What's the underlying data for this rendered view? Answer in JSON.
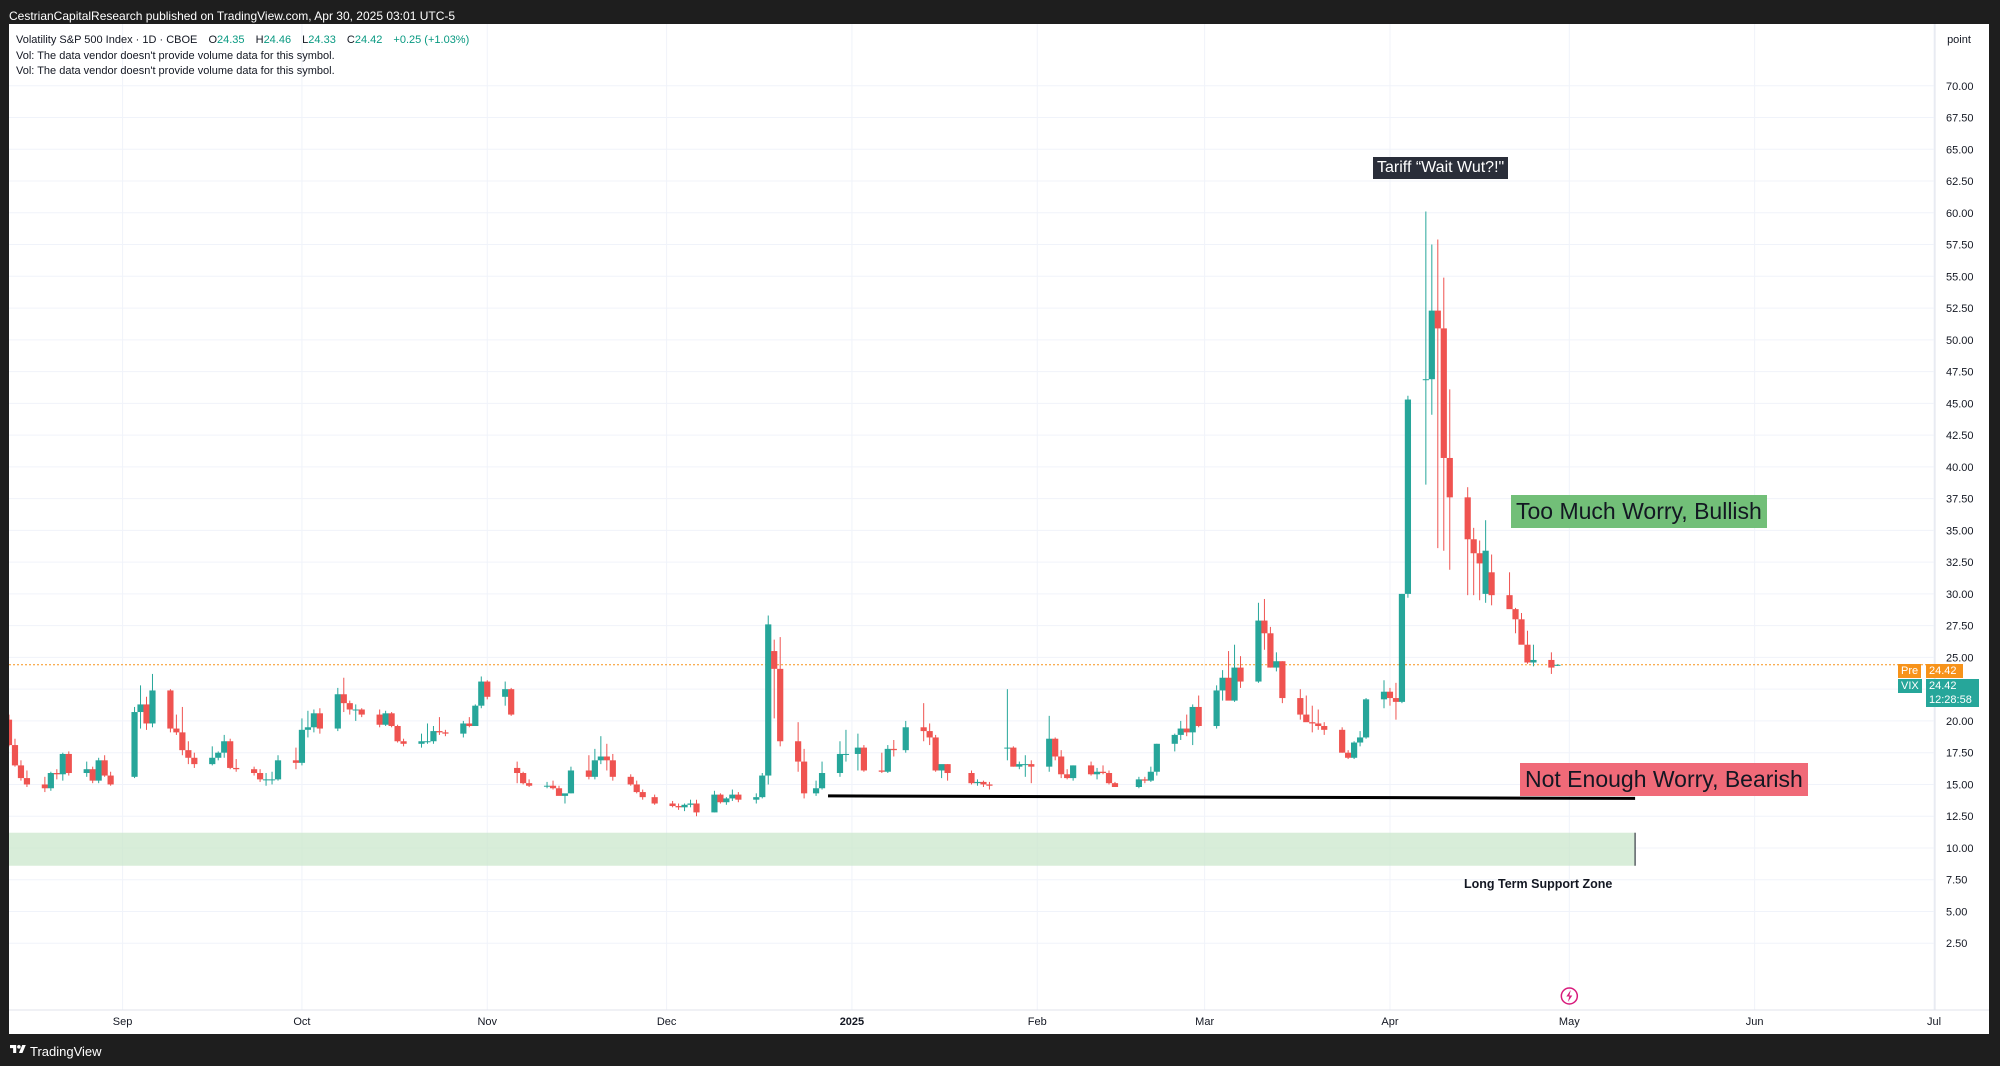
{
  "header": {
    "published": "CestrianCapitalResearch published on TradingView.com, Apr 30, 2025 03:01 UTC-5"
  },
  "footer": {
    "brand": "TradingView",
    "logo_icon": "tradingview-logo-icon"
  },
  "legend": {
    "symbol_line": "Volatility S&P 500 Index · 1D · CBOE",
    "open_label": "O",
    "open": "24.35",
    "high_label": "H",
    "high": "24.46",
    "low_label": "L",
    "low": "24.33",
    "close_label": "C",
    "close": "24.42",
    "change": "+0.25 (+1.03%)",
    "vol_note_1": "Vol: The data vendor doesn't provide volume data for this symbol.",
    "vol_note_2": "Vol: The data vendor doesn't provide volume data for this symbol."
  },
  "annotations": {
    "tariff": "Tariff “Wait Wut?!\"",
    "bullish": "Too Much Worry, Bullish",
    "bearish": "Not Enough Worry, Bearish",
    "support": "Long Term Support Zone"
  },
  "price_tags": {
    "pre_label": "Pre",
    "pre_value": "24.42",
    "vix_label": "VIX",
    "vix_value": "24.42",
    "countdown": "12:28:58"
  },
  "colors": {
    "up": "#26a69a",
    "down": "#ef5350",
    "grid": "#f0f3fa",
    "support_zone": "#c8e6c9",
    "bull_box": "#72bf78",
    "bear_box": "#f06a78",
    "pre_tag": "#f7931a",
    "last_price_line": "#f7931a"
  },
  "chart_data": {
    "type": "candlestick",
    "symbol": "VIX",
    "timeframe": "1D",
    "y_axis_unit": "point",
    "ylim": [
      0,
      72.5
    ],
    "y_ticks": [
      "2.50",
      "5.00",
      "7.50",
      "10.00",
      "12.50",
      "15.00",
      "17.50",
      "20.00",
      "22.50",
      "25.00",
      "27.50",
      "30.00",
      "32.50",
      "35.00",
      "37.50",
      "40.00",
      "42.50",
      "45.00",
      "47.50",
      "50.00",
      "52.50",
      "55.00",
      "57.50",
      "60.00",
      "62.50",
      "65.00",
      "67.50",
      "70.00"
    ],
    "x_ticks": [
      {
        "label": "Sep",
        "date": "2024-09-01"
      },
      {
        "label": "Oct",
        "date": "2024-10-01"
      },
      {
        "label": "Nov",
        "date": "2024-11-01"
      },
      {
        "label": "Dec",
        "date": "2024-12-01"
      },
      {
        "label": "2025",
        "date": "2025-01-01"
      },
      {
        "label": "Feb",
        "date": "2025-02-01"
      },
      {
        "label": "Mar",
        "date": "2025-03-01"
      },
      {
        "label": "Apr",
        "date": "2025-04-01"
      },
      {
        "label": "May",
        "date": "2025-05-01"
      },
      {
        "label": "Jun",
        "date": "2025-06-01"
      },
      {
        "label": "Jul",
        "date": "2025-07-01"
      }
    ],
    "x_range": [
      "2024-08-13",
      "2025-07-01"
    ],
    "last_price": 24.42,
    "support_line": {
      "from": "2024-12-28",
      "to": "2025-05-12",
      "y_start": 14.1,
      "y_end": 13.9
    },
    "support_zone": {
      "y_low": 8.6,
      "y_high": 11.2,
      "from": "2024-08-13",
      "to": "2025-05-12"
    },
    "candles": [
      [
        "2024-08-13",
        20.1,
        20.5,
        18.0,
        18.1
      ],
      [
        "2024-08-14",
        18.1,
        18.6,
        16.4,
        16.5
      ],
      [
        "2024-08-15",
        16.5,
        16.9,
        15.3,
        15.5
      ],
      [
        "2024-08-16",
        15.5,
        16.1,
        14.8,
        15.0
      ],
      [
        "2024-08-19",
        15.0,
        15.6,
        14.4,
        14.7
      ],
      [
        "2024-08-20",
        14.7,
        16.0,
        14.5,
        15.9
      ],
      [
        "2024-08-21",
        15.9,
        16.2,
        15.4,
        15.8
      ],
      [
        "2024-08-22",
        15.8,
        17.5,
        15.3,
        17.4
      ],
      [
        "2024-08-23",
        17.4,
        17.6,
        15.7,
        15.9
      ],
      [
        "2024-08-26",
        15.9,
        16.8,
        15.6,
        16.2
      ],
      [
        "2024-08-27",
        16.2,
        16.4,
        15.1,
        15.3
      ],
      [
        "2024-08-28",
        15.3,
        17.1,
        15.1,
        16.9
      ],
      [
        "2024-08-29",
        16.9,
        17.3,
        15.6,
        15.7
      ],
      [
        "2024-08-30",
        15.7,
        16.0,
        14.9,
        15.0
      ],
      [
        "2024-09-03",
        15.6,
        21.1,
        15.5,
        20.7
      ],
      [
        "2024-09-04",
        20.7,
        22.8,
        19.4,
        21.3
      ],
      [
        "2024-09-05",
        21.3,
        21.9,
        19.3,
        19.8
      ],
      [
        "2024-09-06",
        19.8,
        23.7,
        19.5,
        22.4
      ],
      [
        "2024-09-09",
        22.4,
        22.5,
        19.1,
        19.4
      ],
      [
        "2024-09-10",
        19.4,
        20.5,
        18.9,
        19.1
      ],
      [
        "2024-09-11",
        19.1,
        21.1,
        17.3,
        17.7
      ],
      [
        "2024-09-12",
        17.7,
        18.4,
        16.6,
        17.1
      ],
      [
        "2024-09-13",
        17.1,
        17.5,
        16.3,
        16.6
      ],
      [
        "2024-09-16",
        16.6,
        18.0,
        16.5,
        17.1
      ],
      [
        "2024-09-17",
        17.1,
        17.6,
        16.9,
        17.5
      ],
      [
        "2024-09-18",
        17.5,
        18.9,
        17.1,
        18.4
      ],
      [
        "2024-09-19",
        18.4,
        18.6,
        16.2,
        16.3
      ],
      [
        "2024-09-20",
        16.3,
        17.0,
        16.0,
        16.2
      ],
      [
        "2024-09-23",
        16.2,
        16.4,
        15.7,
        15.9
      ],
      [
        "2024-09-24",
        15.9,
        16.2,
        15.2,
        15.4
      ],
      [
        "2024-09-25",
        15.4,
        15.9,
        14.9,
        15.4
      ],
      [
        "2024-09-26",
        15.4,
        16.0,
        15.0,
        15.4
      ],
      [
        "2024-09-27",
        15.4,
        17.3,
        15.3,
        16.9
      ],
      [
        "2024-09-30",
        16.9,
        17.9,
        16.2,
        16.7
      ],
      [
        "2024-10-01",
        16.7,
        20.2,
        16.5,
        19.3
      ],
      [
        "2024-10-02",
        19.3,
        20.8,
        18.7,
        19.5
      ],
      [
        "2024-10-03",
        19.5,
        20.9,
        19.1,
        20.6
      ],
      [
        "2024-10-04",
        20.6,
        21.0,
        19.0,
        19.4
      ],
      [
        "2024-10-07",
        19.4,
        22.6,
        19.2,
        22.1
      ],
      [
        "2024-10-08",
        22.1,
        23.4,
        20.7,
        21.4
      ],
      [
        "2024-10-09",
        21.4,
        21.6,
        20.5,
        20.9
      ],
      [
        "2024-10-10",
        20.9,
        21.3,
        20.0,
        20.9
      ],
      [
        "2024-10-11",
        20.9,
        21.0,
        20.3,
        20.5
      ],
      [
        "2024-10-14",
        20.5,
        20.9,
        19.5,
        19.7
      ],
      [
        "2024-10-15",
        19.7,
        20.8,
        19.6,
        20.6
      ],
      [
        "2024-10-16",
        20.6,
        20.7,
        19.5,
        19.6
      ],
      [
        "2024-10-17",
        19.6,
        19.7,
        18.3,
        18.4
      ],
      [
        "2024-10-18",
        18.4,
        18.6,
        18.0,
        18.2
      ],
      [
        "2024-10-21",
        18.2,
        19.0,
        17.9,
        18.4
      ],
      [
        "2024-10-22",
        18.4,
        19.8,
        18.2,
        18.4
      ],
      [
        "2024-10-23",
        18.4,
        19.6,
        18.2,
        19.2
      ],
      [
        "2024-10-24",
        19.2,
        20.3,
        18.9,
        19.1
      ],
      [
        "2024-10-25",
        19.1,
        19.3,
        18.8,
        19.0
      ],
      [
        "2024-10-28",
        19.0,
        20.0,
        18.7,
        19.8
      ],
      [
        "2024-10-29",
        19.8,
        20.3,
        19.5,
        19.6
      ],
      [
        "2024-10-30",
        19.6,
        21.3,
        19.6,
        21.2
      ],
      [
        "2024-10-31",
        21.2,
        23.5,
        21.0,
        23.1
      ],
      [
        "2024-11-01",
        23.1,
        23.2,
        21.7,
        21.9
      ],
      [
        "2024-11-04",
        21.9,
        23.1,
        21.2,
        22.5
      ],
      [
        "2024-11-05",
        22.5,
        22.6,
        20.4,
        20.5
      ],
      [
        "2024-11-06",
        16.3,
        16.8,
        15.1,
        15.9
      ],
      [
        "2024-11-07",
        15.9,
        16.0,
        15.0,
        15.1
      ],
      [
        "2024-11-08",
        15.1,
        15.4,
        14.8,
        14.9
      ],
      [
        "2024-11-11",
        14.9,
        15.2,
        14.7,
        14.9
      ],
      [
        "2024-11-12",
        14.9,
        15.3,
        14.6,
        14.7
      ],
      [
        "2024-11-13",
        14.7,
        14.9,
        14.2,
        14.1
      ],
      [
        "2024-11-14",
        14.1,
        14.2,
        13.5,
        14.3
      ],
      [
        "2024-11-15",
        14.3,
        16.4,
        14.3,
        16.1
      ],
      [
        "2024-11-18",
        16.1,
        17.3,
        15.4,
        15.6
      ],
      [
        "2024-11-19",
        15.6,
        17.8,
        15.4,
        16.9
      ],
      [
        "2024-11-20",
        16.9,
        18.8,
        16.6,
        17.2
      ],
      [
        "2024-11-21",
        17.2,
        18.2,
        16.1,
        16.9
      ],
      [
        "2024-11-22",
        16.9,
        17.4,
        15.3,
        15.6
      ],
      [
        "2024-11-25",
        15.6,
        15.8,
        14.9,
        15.0
      ],
      [
        "2024-11-26",
        15.0,
        15.3,
        14.3,
        14.4
      ],
      [
        "2024-11-27",
        14.4,
        14.6,
        13.8,
        14.0
      ],
      [
        "2024-11-29",
        14.0,
        14.2,
        13.4,
        13.5
      ],
      [
        "2024-12-02",
        13.5,
        13.7,
        13.2,
        13.3
      ],
      [
        "2024-12-03",
        13.3,
        13.5,
        13.0,
        13.2
      ],
      [
        "2024-12-04",
        13.2,
        13.5,
        12.9,
        13.4
      ],
      [
        "2024-12-05",
        13.4,
        13.8,
        13.2,
        13.5
      ],
      [
        "2024-12-06",
        13.5,
        13.8,
        12.5,
        12.8
      ],
      [
        "2024-12-09",
        12.8,
        14.5,
        12.8,
        14.2
      ],
      [
        "2024-12-10",
        14.2,
        14.3,
        13.5,
        13.6
      ],
      [
        "2024-12-11",
        13.6,
        14.0,
        13.4,
        13.9
      ],
      [
        "2024-12-12",
        13.9,
        14.6,
        13.7,
        14.2
      ],
      [
        "2024-12-13",
        14.2,
        14.4,
        13.6,
        13.8
      ],
      [
        "2024-12-16",
        13.8,
        14.3,
        13.5,
        14.0
      ],
      [
        "2024-12-17",
        14.0,
        15.9,
        13.9,
        15.7
      ],
      [
        "2024-12-18",
        15.7,
        28.3,
        15.0,
        27.6
      ],
      [
        "2024-12-19",
        25.5,
        26.4,
        20.2,
        24.1
      ],
      [
        "2024-12-20",
        24.1,
        26.6,
        18.0,
        18.4
      ],
      [
        "2024-12-23",
        18.4,
        19.9,
        16.0,
        16.8
      ],
      [
        "2024-12-24",
        16.8,
        17.8,
        13.9,
        14.3
      ],
      [
        "2024-12-26",
        14.3,
        15.3,
        14.1,
        14.7
      ],
      [
        "2024-12-27",
        14.7,
        16.8,
        14.6,
        15.9
      ],
      [
        "2024-12-30",
        15.9,
        18.4,
        15.6,
        17.4
      ],
      [
        "2024-12-31",
        17.4,
        19.3,
        16.8,
        17.4
      ],
      [
        "2025-01-02",
        17.4,
        19.0,
        16.1,
        17.9
      ],
      [
        "2025-01-03",
        17.9,
        18.1,
        16.0,
        16.1
      ],
      [
        "2025-01-06",
        16.1,
        17.5,
        15.9,
        16.0
      ],
      [
        "2025-01-07",
        16.0,
        18.1,
        15.9,
        17.8
      ],
      [
        "2025-01-08",
        17.8,
        18.5,
        17.2,
        17.7
      ],
      [
        "2025-01-10",
        17.7,
        20.0,
        17.5,
        19.5
      ],
      [
        "2025-01-13",
        19.5,
        21.4,
        18.4,
        19.2
      ],
      [
        "2025-01-14",
        19.2,
        19.8,
        18.1,
        18.7
      ],
      [
        "2025-01-15",
        18.7,
        18.9,
        16.0,
        16.1
      ],
      [
        "2025-01-16",
        16.1,
        16.5,
        15.5,
        16.6
      ],
      [
        "2025-01-17",
        16.6,
        16.6,
        15.3,
        15.9
      ],
      [
        "2025-01-21",
        15.9,
        16.1,
        15.0,
        15.1
      ],
      [
        "2025-01-22",
        15.1,
        15.4,
        14.9,
        15.2
      ],
      [
        "2025-01-23",
        15.2,
        15.3,
        14.8,
        15.0
      ],
      [
        "2025-01-24",
        15.0,
        15.2,
        14.6,
        14.9
      ],
      [
        "2025-01-27",
        17.9,
        22.5,
        16.9,
        17.9
      ],
      [
        "2025-01-28",
        17.9,
        18.0,
        16.4,
        16.4
      ],
      [
        "2025-01-29",
        16.4,
        16.8,
        16.2,
        16.6
      ],
      [
        "2025-01-30",
        16.6,
        17.3,
        15.6,
        16.6
      ],
      [
        "2025-01-31",
        16.6,
        16.9,
        15.1,
        16.4
      ],
      [
        "2025-02-03",
        16.4,
        20.4,
        16.0,
        18.6
      ],
      [
        "2025-02-04",
        18.6,
        18.7,
        16.9,
        17.2
      ],
      [
        "2025-02-05",
        17.2,
        17.7,
        15.5,
        15.8
      ],
      [
        "2025-02-06",
        15.8,
        16.2,
        15.4,
        15.5
      ],
      [
        "2025-02-07",
        15.5,
        16.5,
        15.3,
        16.5
      ],
      [
        "2025-02-10",
        16.5,
        16.8,
        15.7,
        15.8
      ],
      [
        "2025-02-11",
        15.8,
        16.3,
        15.4,
        16.0
      ],
      [
        "2025-02-12",
        16.0,
        16.5,
        15.8,
        15.9
      ],
      [
        "2025-02-13",
        15.9,
        16.1,
        15.0,
        15.1
      ],
      [
        "2025-02-14",
        15.1,
        15.2,
        14.8,
        14.8
      ],
      [
        "2025-02-18",
        14.8,
        15.6,
        14.7,
        15.4
      ],
      [
        "2025-02-19",
        15.4,
        15.6,
        15.1,
        15.3
      ],
      [
        "2025-02-20",
        15.3,
        16.4,
        15.2,
        16.0
      ],
      [
        "2025-02-21",
        16.0,
        18.2,
        15.7,
        18.2
      ],
      [
        "2025-02-24",
        18.2,
        19.0,
        17.6,
        18.9
      ],
      [
        "2025-02-25",
        18.9,
        20.0,
        18.5,
        19.4
      ],
      [
        "2025-02-26",
        19.4,
        20.5,
        18.8,
        19.1
      ],
      [
        "2025-02-27",
        19.1,
        21.3,
        18.1,
        21.1
      ],
      [
        "2025-02-28",
        21.1,
        22.0,
        19.5,
        19.6
      ],
      [
        "2025-03-03",
        19.6,
        22.8,
        19.4,
        22.4
      ],
      [
        "2025-03-04",
        22.4,
        24.0,
        21.6,
        23.4
      ],
      [
        "2025-03-05",
        23.4,
        25.5,
        21.7,
        21.6
      ],
      [
        "2025-03-06",
        21.6,
        26.0,
        21.5,
        24.2
      ],
      [
        "2025-03-07",
        24.2,
        25.1,
        22.6,
        23.1
      ],
      [
        "2025-03-10",
        23.1,
        29.3,
        23.0,
        27.9
      ],
      [
        "2025-03-11",
        27.9,
        29.6,
        25.6,
        26.9
      ],
      [
        "2025-03-12",
        26.9,
        27.4,
        24.2,
        24.2
      ],
      [
        "2025-03-13",
        24.2,
        25.4,
        23.9,
        24.7
      ],
      [
        "2025-03-14",
        24.7,
        24.7,
        21.4,
        21.8
      ],
      [
        "2025-03-17",
        21.8,
        22.5,
        20.1,
        20.5
      ],
      [
        "2025-03-18",
        20.5,
        22.0,
        20.2,
        19.9
      ],
      [
        "2025-03-19",
        19.9,
        21.2,
        19.1,
        19.8
      ],
      [
        "2025-03-20",
        19.8,
        20.9,
        19.3,
        19.6
      ],
      [
        "2025-03-21",
        19.6,
        19.9,
        18.9,
        19.3
      ],
      [
        "2025-03-24",
        19.3,
        19.5,
        17.5,
        17.5
      ],
      [
        "2025-03-25",
        17.5,
        17.7,
        17.0,
        17.1
      ],
      [
        "2025-03-26",
        17.1,
        18.4,
        17.0,
        18.3
      ],
      [
        "2025-03-27",
        18.3,
        19.2,
        18.0,
        18.7
      ],
      [
        "2025-03-28",
        18.7,
        21.8,
        18.6,
        21.7
      ],
      [
        "2025-03-31",
        21.7,
        23.2,
        21.0,
        22.3
      ],
      [
        "2025-04-01",
        22.3,
        22.6,
        21.2,
        21.8
      ],
      [
        "2025-04-02",
        21.8,
        23.0,
        20.1,
        21.5
      ],
      [
        "2025-04-03",
        21.5,
        30.0,
        21.4,
        30.0
      ],
      [
        "2025-04-04",
        30.0,
        45.6,
        29.7,
        45.3
      ],
      [
        "2025-04-07",
        46.9,
        60.1,
        38.6,
        46.9
      ],
      [
        "2025-04-08",
        46.9,
        57.5,
        44.1,
        52.3
      ],
      [
        "2025-04-09",
        52.3,
        57.9,
        33.6,
        50.9
      ],
      [
        "2025-04-10",
        50.9,
        54.9,
        33.4,
        40.7
      ],
      [
        "2025-04-11",
        40.7,
        46.1,
        31.9,
        37.6
      ],
      [
        "2025-04-14",
        37.6,
        38.4,
        29.9,
        34.3
      ],
      [
        "2025-04-15",
        34.3,
        35.2,
        29.9,
        33.2
      ],
      [
        "2025-04-16",
        33.2,
        34.2,
        29.5,
        32.4
      ],
      [
        "2025-04-17",
        30.0,
        35.8,
        29.3,
        33.4
      ],
      [
        "2025-04-18",
        31.7,
        33.1,
        29.1,
        29.9
      ],
      [
        "2025-04-21",
        29.9,
        31.7,
        29.4,
        28.8
      ],
      [
        "2025-04-22",
        28.8,
        28.9,
        26.9,
        28.0
      ],
      [
        "2025-04-23",
        28.0,
        28.5,
        26.8,
        26.0
      ],
      [
        "2025-04-24",
        26.0,
        27.1,
        24.5,
        24.6
      ],
      [
        "2025-04-25",
        24.6,
        26.0,
        24.3,
        24.8
      ],
      [
        "2025-04-28",
        24.8,
        25.4,
        23.7,
        24.2
      ],
      [
        "2025-04-29",
        24.35,
        24.46,
        24.33,
        24.42
      ]
    ]
  }
}
